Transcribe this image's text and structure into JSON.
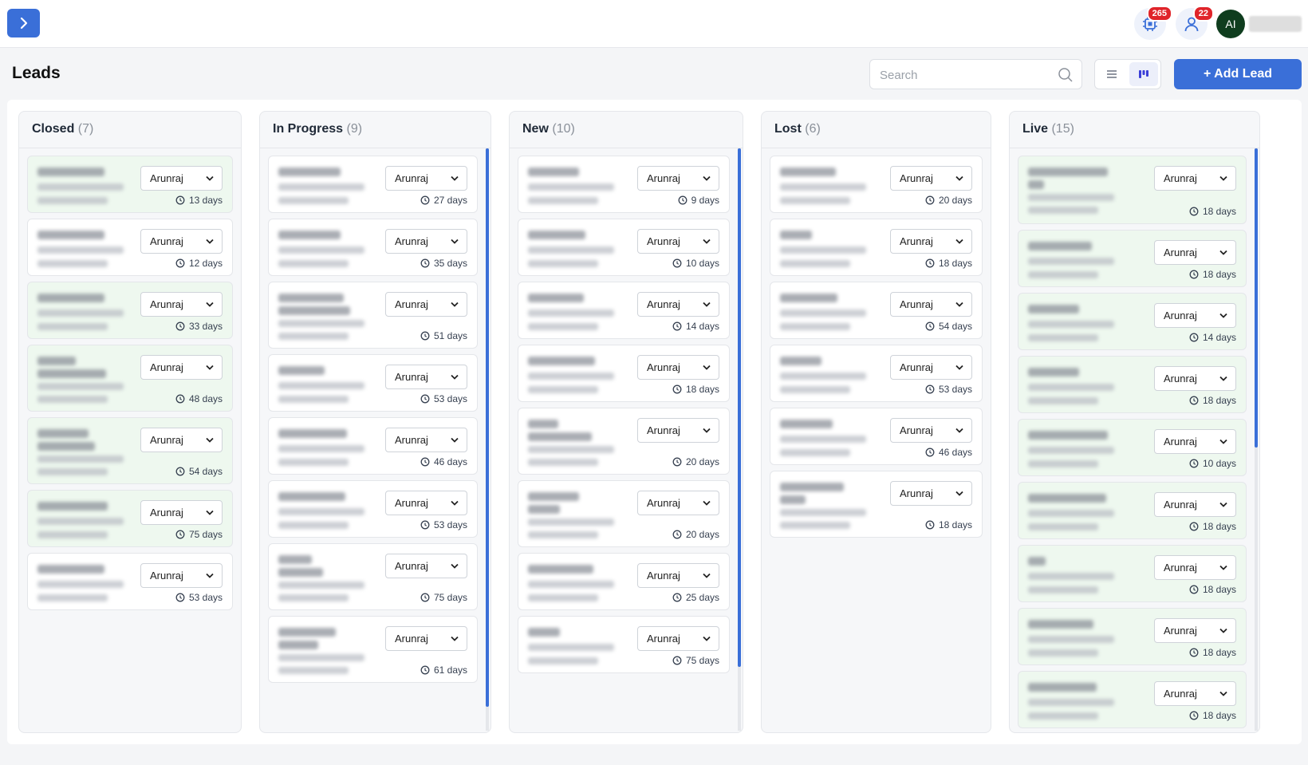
{
  "topbar": {
    "notifications_count": "265",
    "users_count": "22",
    "avatar_initials": "AI"
  },
  "page": {
    "title": "Leads",
    "search_placeholder": "Search",
    "add_lead_label": "+ Add Lead"
  },
  "columns": [
    {
      "title": "Closed",
      "count": "(7)",
      "cards": [
        {
          "assignee": "Arunraj",
          "age": "13 days"
        },
        {
          "assignee": "Arunraj",
          "age": "12 days"
        },
        {
          "assignee": "Arunraj",
          "age": "33 days"
        },
        {
          "assignee": "Arunraj",
          "age": "48 days"
        },
        {
          "assignee": "Arunraj",
          "age": "54 days"
        },
        {
          "assignee": "Arunraj",
          "age": "75 days"
        },
        {
          "assignee": "Arunraj",
          "age": "53 days"
        }
      ]
    },
    {
      "title": "In Progress",
      "count": "(9)",
      "cards": [
        {
          "assignee": "Arunraj",
          "age": "27 days"
        },
        {
          "assignee": "Arunraj",
          "age": "35 days"
        },
        {
          "assignee": "Arunraj",
          "age": "51 days"
        },
        {
          "assignee": "Arunraj",
          "age": "53 days"
        },
        {
          "assignee": "Arunraj",
          "age": "46 days"
        },
        {
          "assignee": "Arunraj",
          "age": "53 days"
        },
        {
          "assignee": "Arunraj",
          "age": "75 days"
        },
        {
          "assignee": "Arunraj",
          "age": "61 days"
        }
      ]
    },
    {
      "title": "New",
      "count": "(10)",
      "cards": [
        {
          "assignee": "Arunraj",
          "age": "9 days"
        },
        {
          "assignee": "Arunraj",
          "age": "10 days"
        },
        {
          "assignee": "Arunraj",
          "age": "14 days"
        },
        {
          "assignee": "Arunraj",
          "age": "18 days"
        },
        {
          "assignee": "Arunraj",
          "age": "20 days"
        },
        {
          "assignee": "Arunraj",
          "age": "20 days"
        },
        {
          "assignee": "Arunraj",
          "age": "25 days"
        },
        {
          "assignee": "Arunraj",
          "age": "75 days"
        }
      ]
    },
    {
      "title": "Lost",
      "count": "(6)",
      "cards": [
        {
          "assignee": "Arunraj",
          "age": "20 days"
        },
        {
          "assignee": "Arunraj",
          "age": "18 days"
        },
        {
          "assignee": "Arunraj",
          "age": "54 days"
        },
        {
          "assignee": "Arunraj",
          "age": "53 days"
        },
        {
          "assignee": "Arunraj",
          "age": "46 days"
        },
        {
          "assignee": "Arunraj",
          "age": "18 days"
        }
      ]
    },
    {
      "title": "Live",
      "count": "(15)",
      "cards": [
        {
          "assignee": "Arunraj",
          "age": "18 days"
        },
        {
          "assignee": "Arunraj",
          "age": "18 days"
        },
        {
          "assignee": "Arunraj",
          "age": "14 days"
        },
        {
          "assignee": "Arunraj",
          "age": "18 days"
        },
        {
          "assignee": "Arunraj",
          "age": "10 days"
        },
        {
          "assignee": "Arunraj",
          "age": "18 days"
        },
        {
          "assignee": "Arunraj",
          "age": "18 days"
        },
        {
          "assignee": "Arunraj",
          "age": "18 days"
        },
        {
          "assignee": "Arunraj",
          "age": "18 days"
        }
      ]
    }
  ]
}
